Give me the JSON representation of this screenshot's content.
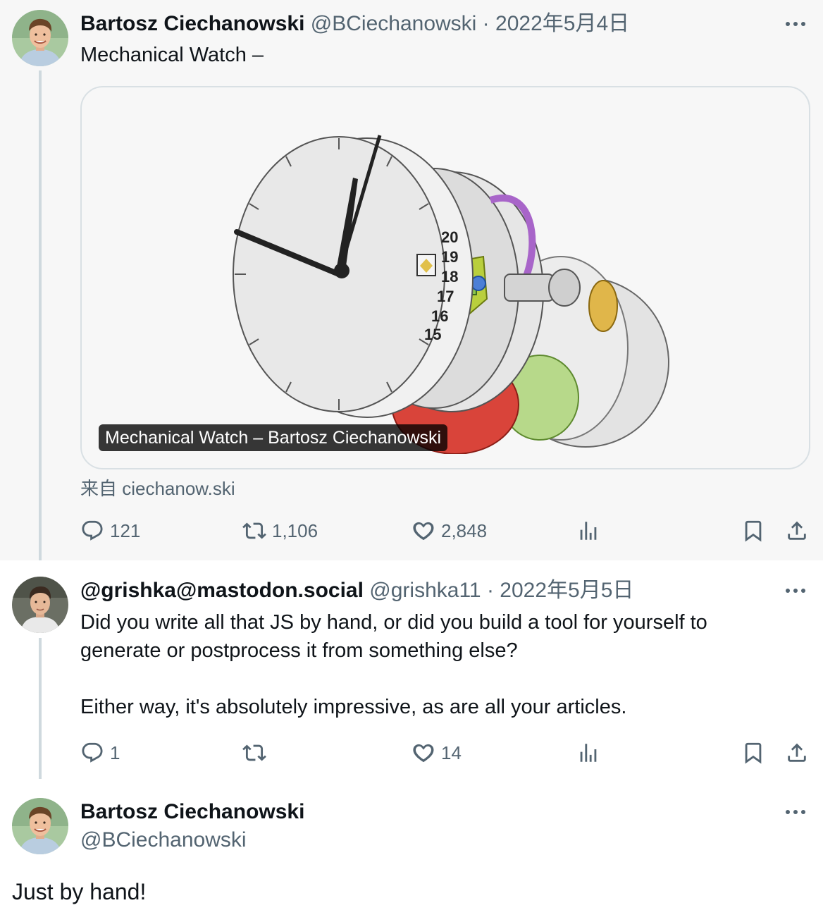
{
  "tweets": [
    {
      "name": "Bartosz Ciechanowski",
      "handle": "@BCiechanowski",
      "separator": "·",
      "date": "2022年5月4日",
      "text": "Mechanical Watch –",
      "card": {
        "title": "Mechanical Watch – Bartosz Ciechanowski",
        "source": "来自 ciechanow.ski"
      },
      "stats": {
        "replies": "121",
        "retweets": "1,106",
        "likes": "2,848"
      }
    },
    {
      "name": "@grishka@mastodon.social",
      "handle": "@grishka11",
      "separator": "·",
      "date": "2022年5月5日",
      "text": "Did you write all that JS by hand, or did you build a tool for yourself to generate or postprocess it from something else?\n\nEither way, it's absolutely impressive, as are all your articles.",
      "stats": {
        "replies": "1",
        "retweets": "",
        "likes": "14"
      }
    },
    {
      "name": "Bartosz Ciechanowski",
      "handle": "@BCiechanowski",
      "text": "Just by hand!"
    }
  ],
  "icons": {
    "reply": "reply-icon",
    "retweet": "retweet-icon",
    "like": "heart-icon",
    "views": "analytics-icon",
    "bookmark": "bookmark-icon",
    "share": "share-icon",
    "more": "more-icon"
  },
  "colors": {
    "text": "#0f1419",
    "secondary": "#536471",
    "thread_line": "#cfd9de",
    "focused_bg": "#f7f7f7"
  }
}
